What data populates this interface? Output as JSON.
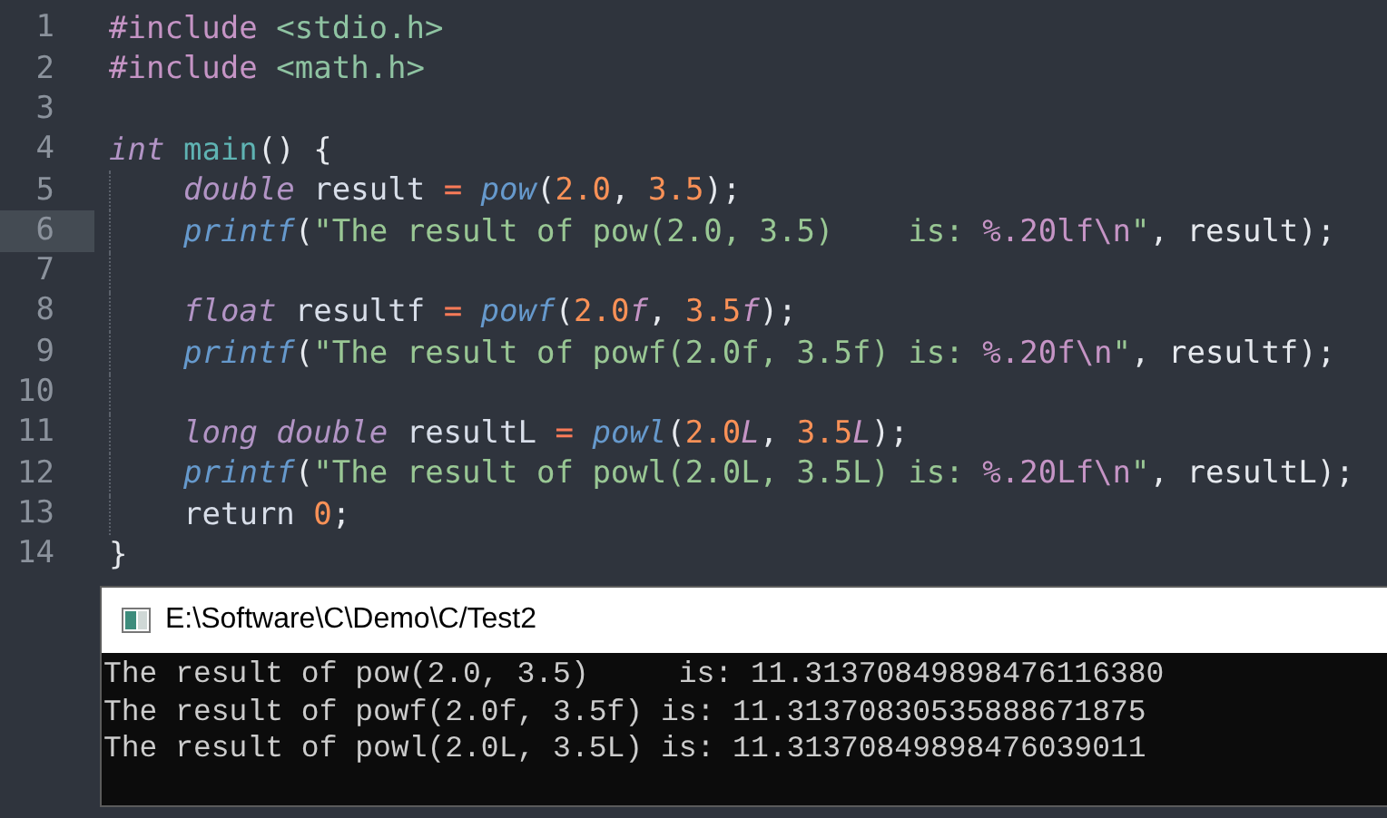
{
  "editor": {
    "lines": [
      {
        "number": "1",
        "selected": false,
        "indent": false,
        "tokens": [
          {
            "t": "#include ",
            "kind": "preproc"
          },
          {
            "t": "<stdio.h>",
            "kind": "header"
          }
        ]
      },
      {
        "number": "2",
        "selected": false,
        "indent": false,
        "tokens": [
          {
            "t": "#include ",
            "kind": "preproc"
          },
          {
            "t": "<math.h>",
            "kind": "header"
          }
        ]
      },
      {
        "number": "3",
        "selected": false,
        "indent": false
      },
      {
        "number": "4",
        "selected": false,
        "indent": false,
        "tokens": [
          {
            "t": "int",
            "kind": "type"
          },
          {
            "t": " main",
            "kind": "def"
          },
          {
            "t": "() {",
            "kind": "punct"
          }
        ]
      },
      {
        "number": "5",
        "selected": false,
        "indent": true,
        "tokens": [
          {
            "t": "double",
            "kind": "type"
          },
          {
            "t": " result ",
            "kind": "plain"
          },
          {
            "t": "= ",
            "kind": "op"
          },
          {
            "t": "pow",
            "kind": "call"
          },
          {
            "t": "(",
            "kind": "punct"
          },
          {
            "t": "2.0",
            "kind": "number"
          },
          {
            "t": ", ",
            "kind": "punct"
          },
          {
            "t": "3.5",
            "kind": "number"
          },
          {
            "t": ");",
            "kind": "punct"
          }
        ]
      },
      {
        "number": "6",
        "selected": true,
        "indent": true,
        "tokens": [
          {
            "t": "printf",
            "kind": "call"
          },
          {
            "t": "(",
            "kind": "punct"
          },
          {
            "t": "\"The result of pow(2.0, 3.5)    is: ",
            "kind": "string"
          },
          {
            "t": "%.20lf\\n",
            "kind": "format"
          },
          {
            "t": "\"",
            "kind": "string"
          },
          {
            "t": ", result);",
            "kind": "punct"
          }
        ]
      },
      {
        "number": "7",
        "selected": false,
        "indent": true
      },
      {
        "number": "8",
        "selected": false,
        "indent": true,
        "tokens": [
          {
            "t": "float",
            "kind": "type"
          },
          {
            "t": " resultf ",
            "kind": "plain"
          },
          {
            "t": "= ",
            "kind": "op"
          },
          {
            "t": "powf",
            "kind": "call"
          },
          {
            "t": "(",
            "kind": "punct"
          },
          {
            "t": "2.0",
            "kind": "number"
          },
          {
            "t": "f",
            "kind": "suffix"
          },
          {
            "t": ", ",
            "kind": "punct"
          },
          {
            "t": "3.5",
            "kind": "number"
          },
          {
            "t": "f",
            "kind": "suffix"
          },
          {
            "t": ");",
            "kind": "punct"
          }
        ]
      },
      {
        "number": "9",
        "selected": false,
        "indent": true,
        "tokens": [
          {
            "t": "printf",
            "kind": "call"
          },
          {
            "t": "(",
            "kind": "punct"
          },
          {
            "t": "\"The result of powf(2.0f, 3.5f) is: ",
            "kind": "string"
          },
          {
            "t": "%.20f\\n",
            "kind": "format"
          },
          {
            "t": "\"",
            "kind": "string"
          },
          {
            "t": ", resultf);",
            "kind": "punct"
          }
        ]
      },
      {
        "number": "10",
        "selected": false,
        "indent": true
      },
      {
        "number": "11",
        "selected": false,
        "indent": true,
        "tokens": [
          {
            "t": "long double",
            "kind": "type"
          },
          {
            "t": " resultL ",
            "kind": "plain"
          },
          {
            "t": "= ",
            "kind": "op"
          },
          {
            "t": "powl",
            "kind": "call"
          },
          {
            "t": "(",
            "kind": "punct"
          },
          {
            "t": "2.0",
            "kind": "number"
          },
          {
            "t": "L",
            "kind": "suffix"
          },
          {
            "t": ", ",
            "kind": "punct"
          },
          {
            "t": "3.5",
            "kind": "number"
          },
          {
            "t": "L",
            "kind": "suffix"
          },
          {
            "t": ");",
            "kind": "punct"
          }
        ]
      },
      {
        "number": "12",
        "selected": false,
        "indent": true,
        "tokens": [
          {
            "t": "printf",
            "kind": "call"
          },
          {
            "t": "(",
            "kind": "punct"
          },
          {
            "t": "\"The result of powl(2.0L, 3.5L) is: ",
            "kind": "string"
          },
          {
            "t": "%.20Lf\\n",
            "kind": "format"
          },
          {
            "t": "\"",
            "kind": "string"
          },
          {
            "t": ", resultL);",
            "kind": "punct"
          }
        ]
      },
      {
        "number": "13",
        "selected": false,
        "indent": true,
        "tokens": [
          {
            "t": "return ",
            "kind": "plain"
          },
          {
            "t": "0",
            "kind": "number"
          },
          {
            "t": ";",
            "kind": "punct"
          }
        ]
      },
      {
        "number": "14",
        "selected": false,
        "indent": false,
        "tokens": [
          {
            "t": "}",
            "kind": "punct"
          }
        ]
      }
    ]
  },
  "console": {
    "title": "E:\\Software\\C\\Demo\\C/Test2",
    "output": [
      "The result of pow(2.0, 3.5)     is: 11.31370849898476116380",
      "The result of powf(2.0f, 3.5f) is: 11.31370830535888671875",
      "The result of powl(2.0L, 3.5L) is: 11.31370849898476039011"
    ]
  }
}
